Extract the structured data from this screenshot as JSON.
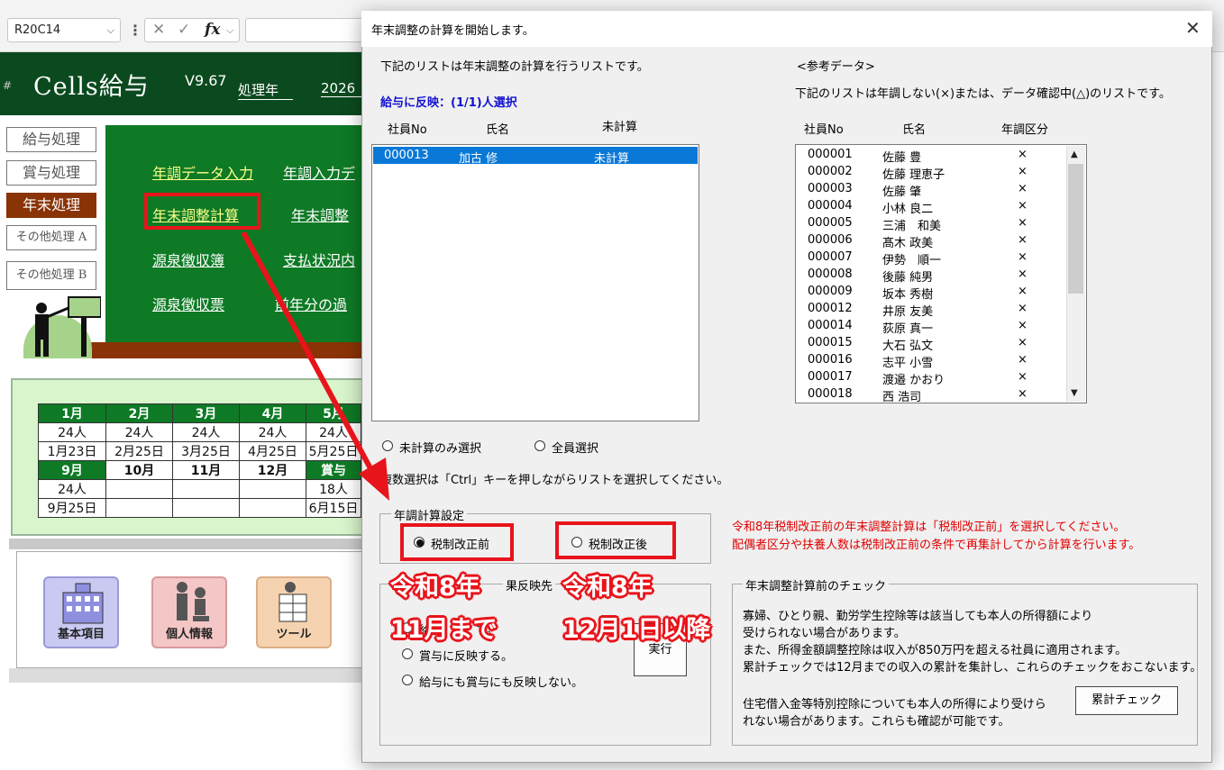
{
  "excel": {
    "name_box": "R20C14",
    "name_box_arrow": "⌵",
    "menu_dots": "⋮",
    "cancel_symbol": "✕",
    "enter_symbol": "✓",
    "fx_label": "fx",
    "fx_arrow": "⌵"
  },
  "sheet": {
    "app_title": "Cells給与",
    "version": "V9.67",
    "year_label": "処理年",
    "year_value": "2026",
    "hash": "#",
    "nav": [
      "給与処理",
      "賞与処理",
      "年末処理",
      "その他処理 A",
      "その他処理 B"
    ],
    "menu": {
      "row1": [
        "年調データ入力",
        "年調入力デ"
      ],
      "row2": [
        "年末調整計算",
        "年末調整"
      ],
      "row3": [
        "源泉徴収簿",
        "支払状況内"
      ],
      "row4": [
        "源泉徴収票",
        "前年分の過"
      ]
    },
    "calendar": {
      "row1": [
        "1月",
        "2月",
        "3月",
        "4月",
        "5月"
      ],
      "row2": [
        "24人",
        "24人",
        "24人",
        "24人",
        "24人"
      ],
      "row3": [
        "1月23日",
        "2月25日",
        "3月25日",
        "4月25日",
        "5月25日"
      ],
      "row4": [
        "9月",
        "10月",
        "11月",
        "12月",
        "賞与"
      ],
      "row5": [
        "24人",
        "",
        "",
        "",
        "18人"
      ],
      "row6": [
        "9月25日",
        "",
        "",
        "",
        "6月15日"
      ]
    },
    "tiles": [
      "基本項目",
      "個人情報",
      "ツール"
    ]
  },
  "dialog": {
    "title": "年末調整の計算を開始します。",
    "close_symbol": "✕",
    "left_caption": "下記のリストは年末調整の計算を行うリストです。",
    "selection_info": "給与に反映：(1/1)人選択",
    "left_headers": [
      "社員No",
      "氏名",
      "未計算"
    ],
    "left_rows": [
      {
        "no": "000013",
        "name": "加古 修",
        "status": "未計算"
      }
    ],
    "ref_title": "<参考データ>",
    "ref_caption": "下記のリストは年調しない(×)または、データ確認中(△)のリストです。",
    "right_headers": [
      "社員No",
      "氏名",
      "年調区分"
    ],
    "right_rows": [
      {
        "no": "000001",
        "name": "佐藤 豊",
        "mark": "×"
      },
      {
        "no": "000002",
        "name": "佐藤 理恵子",
        "mark": "×"
      },
      {
        "no": "000003",
        "name": "佐藤 肇",
        "mark": "×"
      },
      {
        "no": "000004",
        "name": "小林 良二",
        "mark": "×"
      },
      {
        "no": "000005",
        "name": "三浦　和美",
        "mark": "×"
      },
      {
        "no": "000006",
        "name": "髙木 政美",
        "mark": "×"
      },
      {
        "no": "000007",
        "name": "伊勢　順一",
        "mark": "×"
      },
      {
        "no": "000008",
        "name": "後藤 純男",
        "mark": "×"
      },
      {
        "no": "000009",
        "name": "坂本 秀樹",
        "mark": "×"
      },
      {
        "no": "000012",
        "name": "井原 友美",
        "mark": "×"
      },
      {
        "no": "000014",
        "name": "荻原 真一",
        "mark": "×"
      },
      {
        "no": "000015",
        "name": "大石 弘文",
        "mark": "×"
      },
      {
        "no": "000016",
        "name": "志平 小雪",
        "mark": "×"
      },
      {
        "no": "000017",
        "name": "渡邉 かおり",
        "mark": "×"
      },
      {
        "no": "000018",
        "name": "西 浩司",
        "mark": "×"
      }
    ],
    "scroll_up": "▲",
    "scroll_down": "▼",
    "radio_uncalc": "未計算のみ選択",
    "radio_all": "全員選択",
    "ctrl_hint": "複数選択は「Ctrl」キーを押しながらリストを選択してください。",
    "group_setting_title": "年調計算設定",
    "radio_before": "税制改正前",
    "radio_after": "税制改正後",
    "red_note_1": "令和8年税制改正前の年末調整計算は「税制改正前」を選択してください。",
    "red_note_2": "配偶者区分や扶養人数は税制改正前の条件で再集計してから計算を行います。",
    "reflect_title_tail": "果反映先",
    "reflect_partial": "給",
    "reflect_partial2": "す。",
    "radio_bonus": "賞与に反映する。",
    "radio_none": "給与にも賞与にも反映しない。",
    "execute": "実行",
    "check_title": "年末調整計算前のチェック",
    "check_lines": [
      "寡婦、ひとり親、勤労学生控除等は該当しても本人の所得額により",
      "受けられない場合があります。",
      "また、所得金額調整控除は収入が850万円を超える社員に適用されます。",
      "累計チェックでは12月までの収入の累計を集計し、これらのチェックをおこないます。"
    ],
    "check_lines_2": [
      "住宅借入金等特別控除についても本人の所得により受けら",
      "れない場合があります。これらも確認が可能です。"
    ],
    "cumulative_check": "累計チェック"
  },
  "overlay": {
    "before_1": "令和8年",
    "before_2": "11月まで",
    "after_1": "令和8年",
    "after_2": "12月1日以降"
  }
}
